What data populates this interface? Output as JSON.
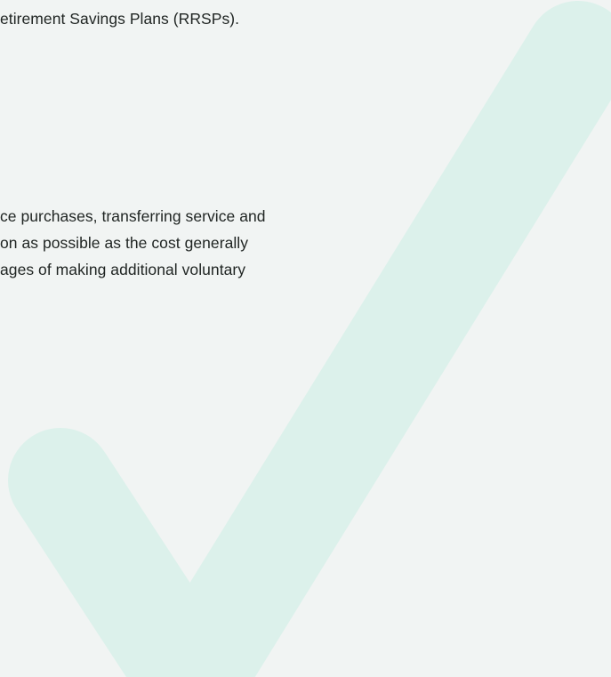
{
  "document": {
    "lines": [
      "etirement Savings Plans (RRSPs).",
      "ce purchases, transferring service and",
      "on as possible as the cost generally",
      "ages of making additional voluntary"
    ]
  },
  "colors": {
    "background": "#f1f4f3",
    "checkmark": "#dcf1eb",
    "text": "#1f2422"
  }
}
